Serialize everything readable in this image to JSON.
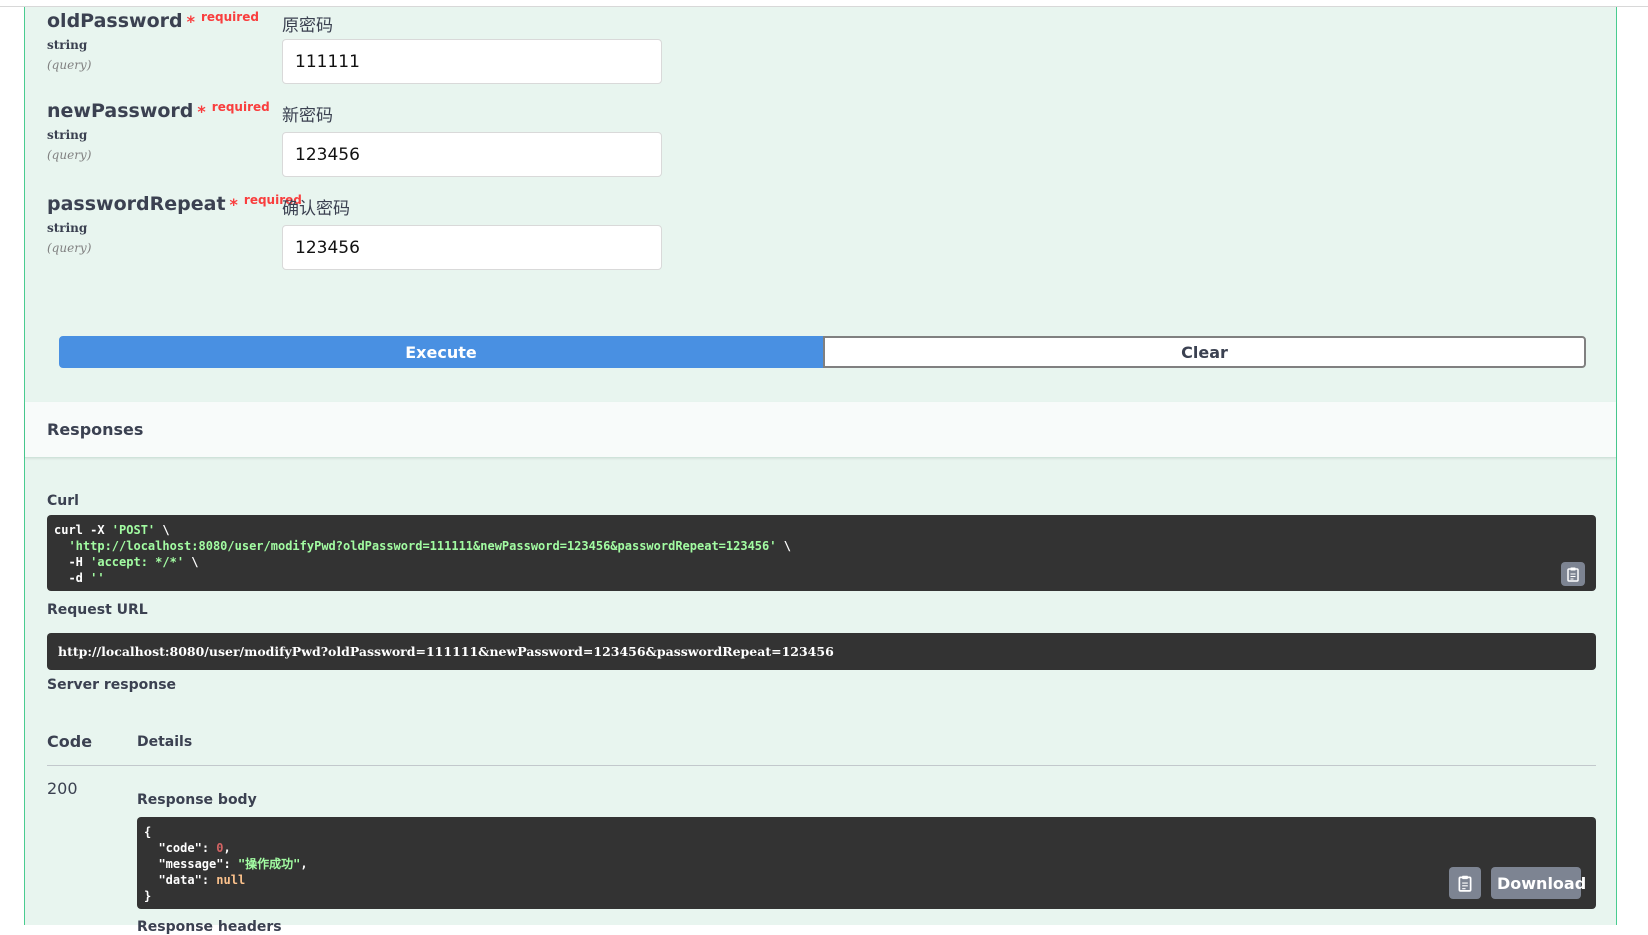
{
  "params": [
    {
      "name": "oldPassword",
      "star": "*",
      "required": "required",
      "type": "string",
      "in": "(query)",
      "description": "原密码",
      "value": "111111"
    },
    {
      "name": "newPassword",
      "star": "*",
      "required": "required",
      "type": "string",
      "in": "(query)",
      "description": "新密码",
      "value": "123456"
    },
    {
      "name": "passwordRepeat",
      "star": "*",
      "required": "required",
      "type": "string",
      "in": "(query)",
      "description": "确认密码",
      "value": "123456"
    }
  ],
  "buttons": {
    "execute": "Execute",
    "clear": "Clear",
    "download": "Download"
  },
  "responses": {
    "title": "Responses",
    "curl_label": "Curl",
    "curl": {
      "l1a": "curl -X ",
      "l1b": "'POST'",
      "l1c": " \\",
      "l2a": "  ",
      "l2b": "'http://localhost:8080/user/modifyPwd?oldPassword=111111&newPassword=123456&passwordRepeat=123456'",
      "l2c": " \\",
      "l3a": "  -H ",
      "l3b": "'accept: */*'",
      "l3c": " \\",
      "l4a": "  -d ",
      "l4b": "''"
    },
    "request_url_label": "Request URL",
    "request_url": "http://localhost:8080/user/modifyPwd?oldPassword=111111&newPassword=123456&passwordRepeat=123456",
    "server_response_label": "Server response",
    "code_header": "Code",
    "details_header": "Details",
    "status_code": "200",
    "response_body_label": "Response body",
    "body": {
      "open": "{",
      "k_code": "\"code\"",
      "v_code": "0",
      "k_message": "\"message\"",
      "v_message": "\"操作成功\"",
      "k_data": "\"data\"",
      "v_data": "null",
      "close": "}"
    },
    "response_headers_label": "Response headers"
  },
  "colors": {
    "accent": "#49cc90",
    "execute": "#4990e2",
    "code_bg": "#333333"
  }
}
